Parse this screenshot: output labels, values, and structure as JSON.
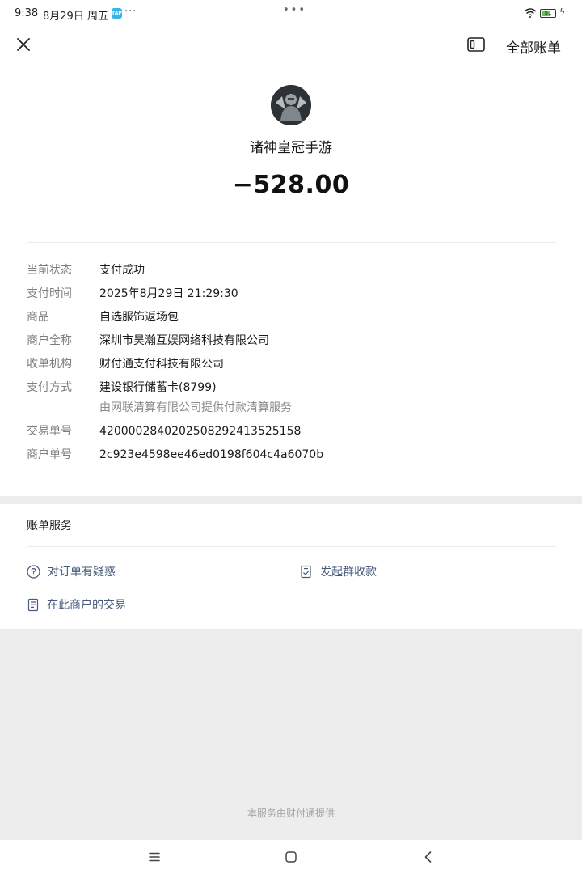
{
  "status_bar": {
    "time": "9:38",
    "date": "8月29日 周五",
    "app_badge": "TAP",
    "more": "···",
    "center_dots": "•••",
    "battery": "51"
  },
  "topbar": {
    "all_bills_label": "全部账单"
  },
  "merchant": {
    "name": "诸神皇冠手游",
    "amount": "−528.00"
  },
  "details": [
    {
      "label": "当前状态",
      "value": "支付成功"
    },
    {
      "label": "支付时间",
      "value": "2025年8月29日 21:29:30"
    },
    {
      "label": "商品",
      "value": "自选服饰返场包"
    },
    {
      "label": "商户全称",
      "value": "深圳市昊瀚互娱网络科技有限公司"
    },
    {
      "label": "收单机构",
      "value": "财付通支付科技有限公司"
    },
    {
      "label": "支付方式",
      "value": "建设银行储蓄卡(8799)",
      "sub": "由网联清算有限公司提供付款清算服务"
    },
    {
      "label": "交易单号",
      "value": "4200002840202508292413525158"
    },
    {
      "label": "商户单号",
      "value": "2c923e4598ee46ed0198f604c4a6070b"
    }
  ],
  "service": {
    "title": "账单服务",
    "items": [
      {
        "label": "对订单有疑惑",
        "icon": "question-circle-icon"
      },
      {
        "label": "发起群收款",
        "icon": "receipt-check-icon"
      },
      {
        "label": "在此商户的交易",
        "icon": "document-list-icon"
      }
    ]
  },
  "footer_note": "本服务由财付通提供",
  "colors": {
    "link": "#465a7a",
    "label": "#7d7d7d",
    "background": "#ededed"
  }
}
